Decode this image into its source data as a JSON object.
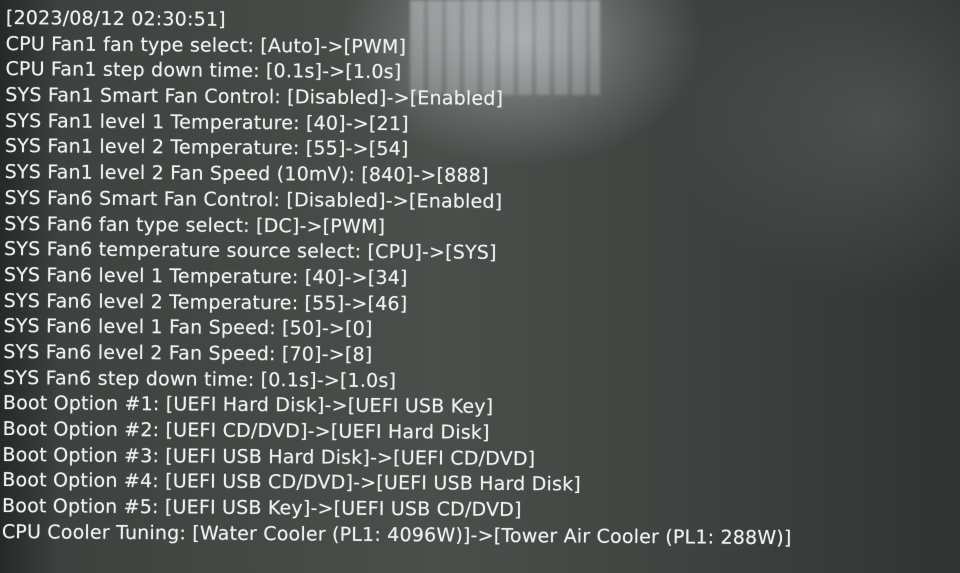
{
  "log": {
    "timestamp": "[2023/08/12 02:30:51]",
    "lines": [
      "CPU Fan1 fan type select: [Auto]->[PWM]",
      "CPU Fan1 step down time: [0.1s]->[1.0s]",
      "SYS Fan1 Smart Fan Control: [Disabled]->[Enabled]",
      "SYS Fan1 level 1 Temperature: [40]->[21]",
      "SYS Fan1 level 2 Temperature: [55]->[54]",
      "SYS Fan1 level 2 Fan Speed (10mV): [840]->[888]",
      "SYS Fan6 Smart Fan Control: [Disabled]->[Enabled]",
      "SYS Fan6 fan type select: [DC]->[PWM]",
      "SYS Fan6 temperature source select: [CPU]->[SYS]",
      "SYS Fan6 level 1 Temperature: [40]->[34]",
      "SYS Fan6 level 2 Temperature: [55]->[46]",
      "SYS Fan6 level 1 Fan Speed: [50]->[0]",
      "SYS Fan6 level 2 Fan Speed: [70]->[8]",
      "SYS Fan6 step down time: [0.1s]->[1.0s]",
      "Boot Option #1: [UEFI Hard Disk]->[UEFI USB Key]",
      "Boot Option #2: [UEFI CD/DVD]->[UEFI Hard Disk]",
      "Boot Option #3: [UEFI USB Hard Disk]->[UEFI CD/DVD]",
      "Boot Option #4: [UEFI USB CD/DVD]->[UEFI USB Hard Disk]",
      "Boot Option #5: [UEFI USB Key]->[UEFI USB CD/DVD]",
      "CPU Cooler Tuning: [Water Cooler (PL1: 4096W)]->[Tower Air Cooler (PL1: 288W)]"
    ]
  },
  "colors": {
    "text": "#eef0ee",
    "background": "#444945"
  }
}
